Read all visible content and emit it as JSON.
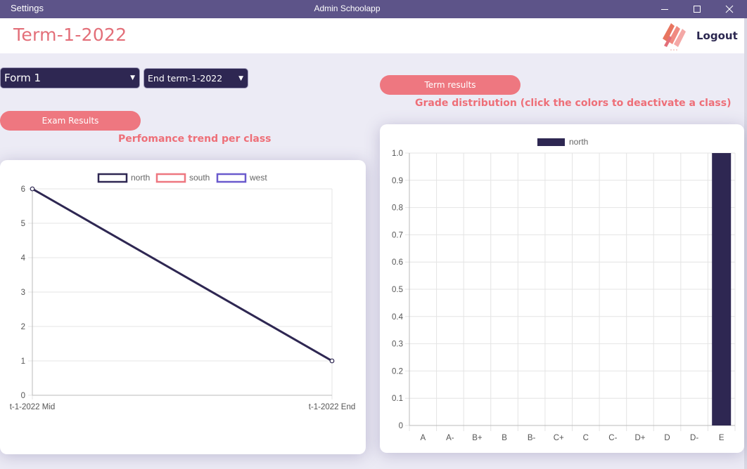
{
  "window": {
    "settings_label": "Settings",
    "title": "Admin Schoolapp"
  },
  "header": {
    "page_title": "Term-1-2022",
    "logout_label": "Logout"
  },
  "controls": {
    "form_select_value": "Form 1",
    "term_select_value": "End term-1-2022",
    "exam_results_button": "Exam Results",
    "term_results_button": "Term results"
  },
  "labels": {
    "trend": "Perfomance trend per class",
    "grade_distribution": "Grade distribution (click the colors to deactivate a class)"
  },
  "colors": {
    "accent": "#ee7780",
    "titlebar": "#5d5489",
    "dark": "#2e2752"
  },
  "icons": {
    "minimize": "minimize-icon",
    "maximize": "maximize-icon",
    "close": "close-icon",
    "logo": "app-logo"
  },
  "chart_data": [
    {
      "type": "line",
      "categories": [
        "t-1-2022 Mid",
        "t-1-2022 End"
      ],
      "series": [
        {
          "name": "north",
          "values": [
            6,
            1
          ],
          "color": "#2e2752"
        },
        {
          "name": "south",
          "values": [],
          "color": "#ee7780"
        },
        {
          "name": "west",
          "values": [],
          "color": "#6a5acd"
        }
      ],
      "ylim": [
        0,
        6
      ],
      "yticks": [
        0,
        1,
        2,
        3,
        4,
        5,
        6
      ],
      "grid": true,
      "legend_position": "top"
    },
    {
      "type": "bar",
      "categories": [
        "A",
        "A-",
        "B+",
        "B",
        "B-",
        "C+",
        "C",
        "C-",
        "D+",
        "D",
        "D-",
        "E"
      ],
      "series": [
        {
          "name": "north",
          "values": [
            0,
            0,
            0,
            0,
            0,
            0,
            0,
            0,
            0,
            0,
            0,
            1
          ],
          "color": "#2e2752"
        }
      ],
      "ylim": [
        0,
        1
      ],
      "yticks": [
        "0",
        "0.1",
        "0.2",
        "0.3",
        "0.4",
        "0.5",
        "0.6",
        "0.7",
        "0.8",
        "0.9",
        "1.0"
      ],
      "grid": true,
      "legend_position": "top"
    }
  ]
}
